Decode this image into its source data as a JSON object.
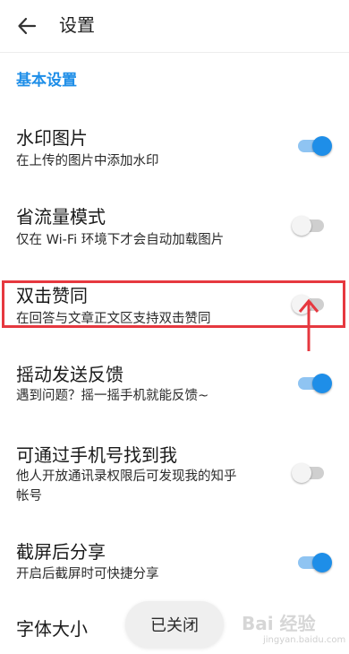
{
  "header": {
    "title": "设置",
    "back_icon": "arrow-left-icon"
  },
  "section": {
    "title": "基本设置",
    "accent_color": "#1e8ee8"
  },
  "settings": [
    {
      "title": "水印图片",
      "desc": "在上传的图片中添加水印",
      "enabled": true
    },
    {
      "title": "省流量模式",
      "desc": "仅在 Wi-Fi 环境下才会自动加载图片",
      "enabled": false
    },
    {
      "title": "双击赞同",
      "desc": "在回答与文章正文区支持双击赞同",
      "enabled": false
    },
    {
      "title": "摇动发送反馈",
      "desc": "遇到问题？摇一摇手机就能反馈~",
      "enabled": true
    },
    {
      "title": "可通过手机号找到我",
      "desc": "他人开放通讯录权限后可发现我的知乎帐号",
      "enabled": false
    },
    {
      "title": "截屏后分享",
      "desc": "开启后截屏时可快捷分享",
      "enabled": true
    },
    {
      "title": "字体大小"
    }
  ],
  "toast": {
    "text": "已关闭"
  },
  "annotation": {
    "highlight_color": "#e6383f"
  },
  "watermark": {
    "logo": "Bai 经验",
    "sub": "jingyan.baidu.com"
  },
  "colors": {
    "toggle_on_thumb": "#1e8ee8",
    "toggle_on_track": "#8fc4f2",
    "toggle_off_thumb": "#f4f4f4",
    "toggle_off_track": "#cfcfcf"
  }
}
